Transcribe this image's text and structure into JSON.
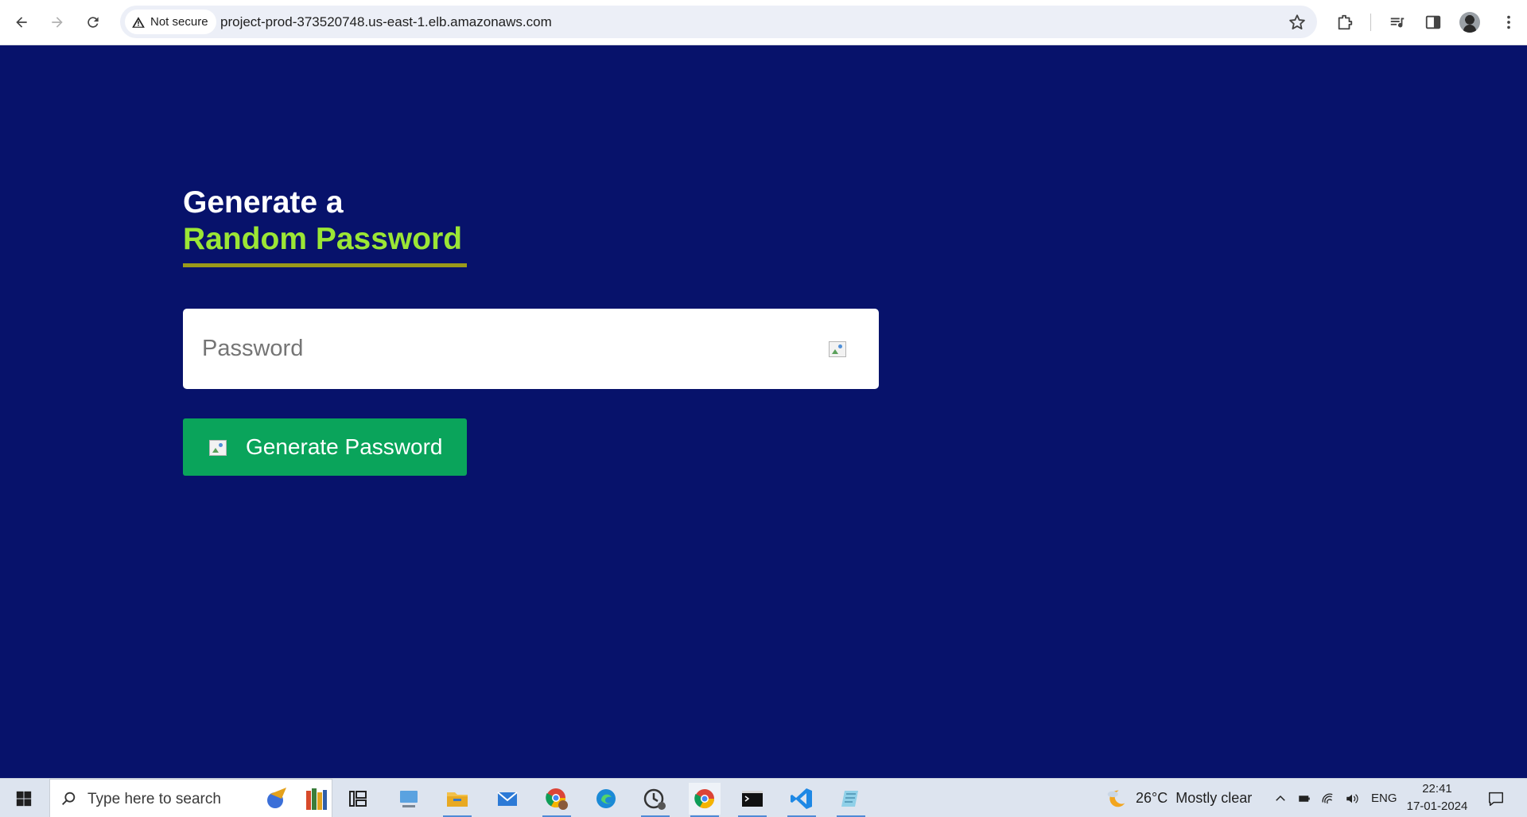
{
  "browser": {
    "security_label": "Not secure",
    "url": "project-prod-373520748.us-east-1.elb.amazonaws.com",
    "icons": [
      "back-icon",
      "forward-icon",
      "reload-icon",
      "warning-icon",
      "star-icon",
      "extensions-icon",
      "media-controls-icon",
      "side-panel-icon",
      "profile-avatar",
      "menu-icon"
    ]
  },
  "page": {
    "heading_line1": "Generate a",
    "heading_line2": "Random Password",
    "password_placeholder": "Password",
    "password_value": "",
    "generate_button_label": "Generate Password",
    "colors": {
      "background": "#07126b",
      "heading_white": "#ffffff",
      "heading_accent": "#9be635",
      "underline": "#9a9a1a",
      "button": "#0aa45b"
    }
  },
  "taskbar": {
    "search_placeholder": "Type here to search",
    "weather_temp": "26°C",
    "weather_desc": "Mostly clear",
    "language": "ENG",
    "time": "22:41",
    "date": "17-01-2024",
    "apps": [
      "task-view",
      "this-pc",
      "file-explorer",
      "mail",
      "chrome-profile",
      "edge",
      "clock-app",
      "chrome",
      "terminal",
      "vscode",
      "notepad"
    ]
  }
}
